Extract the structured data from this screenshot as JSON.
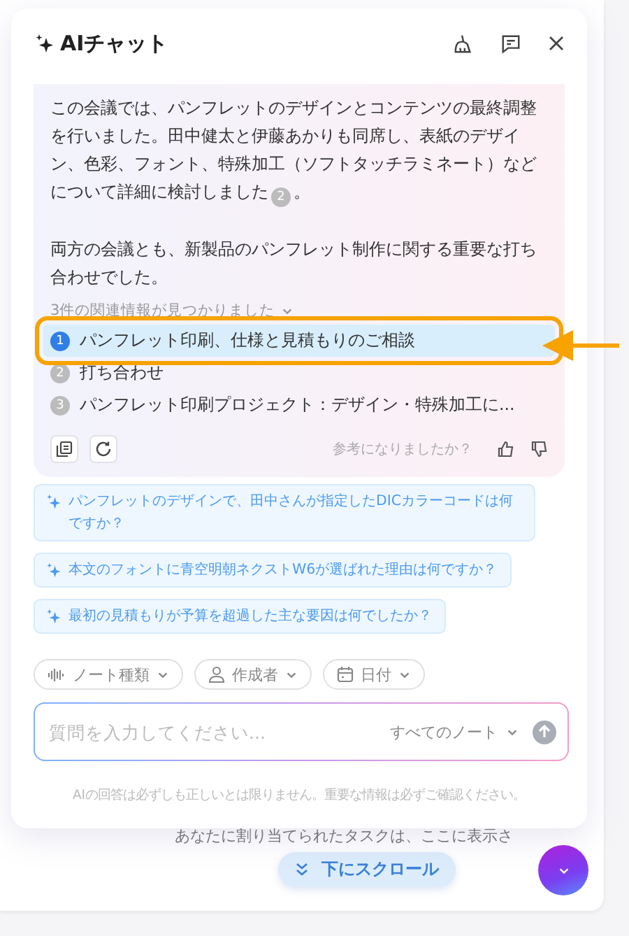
{
  "panel": {
    "title": "AIチャット"
  },
  "answer": {
    "paragraphs": [
      {
        "text": "この会議では、パンフレットのデザインとコンテンツの最終調整を行いました。田中健太と伊藤あかりも同席し、表紙のデザイン、色彩、フォント、特殊加工（ソフトタッチラミネート）などについて詳細に検討しました",
        "citation": "2",
        "after": "。"
      },
      {
        "text": "両方の会議とも、新製品のパンフレット制作に関する重要な打ち合わせでした。"
      }
    ],
    "sources_label": "3件の関連情報が見つかりました",
    "sources": [
      {
        "number": "1",
        "title": "パンフレット印刷、仕様と見積もりのご相談",
        "selected": true,
        "highlighted": true
      },
      {
        "number": "2",
        "title": "打ち合わせ",
        "selected": false,
        "highlighted": false
      },
      {
        "number": "3",
        "title": "パンフレット印刷プロジェクト：デザイン・特殊加工に...",
        "selected": false,
        "highlighted": false
      }
    ],
    "feedback_prompt": "参考になりましたか？"
  },
  "suggestions": [
    "パンフレットのデザインで、田中さんが指定したDICカラーコードは何ですか？",
    "本文のフォントに青空明朝ネクストW6が選ばれた理由は何ですか？",
    "最初の見積もりが予算を超過した主な要因は何でしたか？"
  ],
  "filters": [
    {
      "label": "ノート種類",
      "kind": "type"
    },
    {
      "label": "作成者",
      "kind": "author"
    },
    {
      "label": "日付",
      "kind": "date"
    }
  ],
  "input": {
    "placeholder": "質問を入力してください...",
    "scope": "すべてのノート"
  },
  "disclaimer": "AIの回答は必ずしも正しいとは限りません。重要な情報は必ずご確認ください。",
  "background": {
    "text": "あなたに割り当てられたタスクは、ここに表示さ",
    "scroll_button": "下にスクロール"
  }
}
